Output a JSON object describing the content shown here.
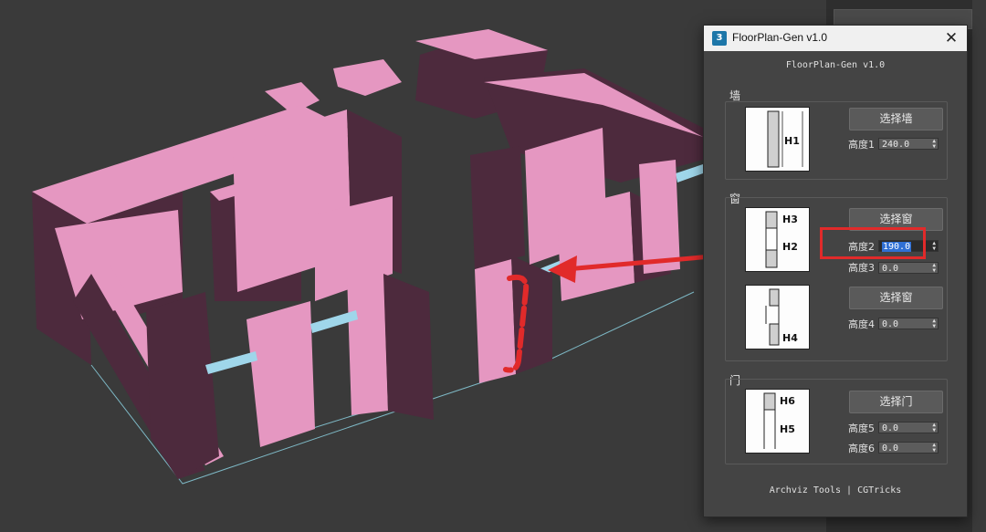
{
  "window": {
    "title": "FloorPlan-Gen v1.0",
    "icon": "3ds-max-icon",
    "close_glyph": "✕"
  },
  "header": "FloorPlan-Gen v1.0",
  "wall_group": {
    "label": "墙",
    "button": "选择墙",
    "diagram_label": "H1",
    "field_label": "高度1",
    "field_value": "240.0"
  },
  "window_group": {
    "label": "窗",
    "button1": "选择窗",
    "diagram1_labels": [
      "H3",
      "H2"
    ],
    "field2_label": "高度2",
    "field2_value": "190.0",
    "field3_label": "高度3",
    "field3_value": "0.0",
    "button2": "选择窗",
    "diagram2_label": "H4",
    "field4_label": "高度4",
    "field4_value": "0.0"
  },
  "door_group": {
    "label": "门",
    "button": "选择门",
    "diagram_labels": [
      "H6",
      "H5"
    ],
    "field5_label": "高度5",
    "field5_value": "0.0",
    "field6_label": "高度6",
    "field6_value": "0.0"
  },
  "footer": "Archviz Tools | CGTricks",
  "colors": {
    "wall_top": "#e597c1",
    "wall_side": "#4d2a3d",
    "window_strip": "#9fd6ea",
    "annotation": "#e12a2a",
    "dialog_bg": "#444444"
  }
}
